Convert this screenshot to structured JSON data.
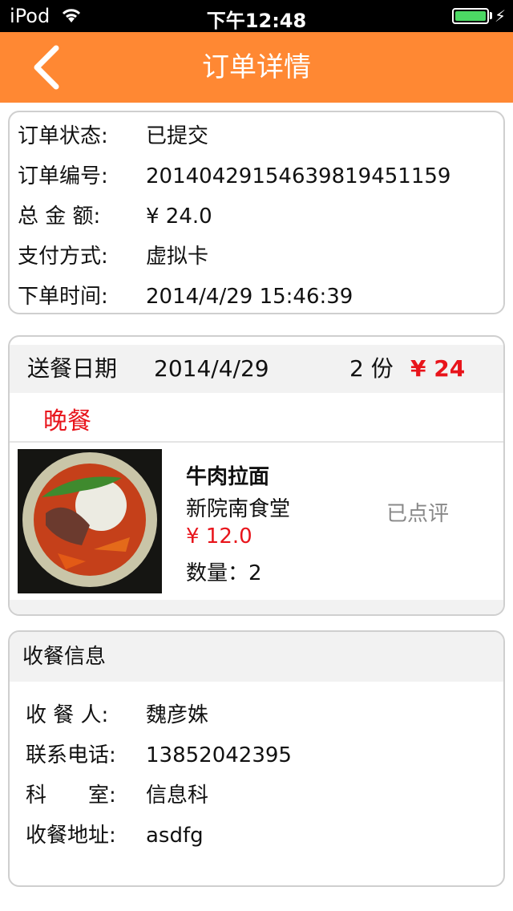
{
  "status_bar": {
    "carrier": "iPod",
    "time": "下午12:48",
    "battery_level": 1.0,
    "icons": [
      "wifi-icon",
      "battery-icon",
      "charging-icon"
    ]
  },
  "nav": {
    "title": "订单详情",
    "back_icon": "chevron-left-icon"
  },
  "order": {
    "status_label": "订单状态:",
    "status_value": "已提交",
    "number_label": "订单编号:",
    "number_value": "20140429154639819451159",
    "amount_label": "总 金 额:",
    "amount_value": "¥ 24.0",
    "payment_label": "支付方式:",
    "payment_value": "虚拟卡",
    "time_label": "下单时间:",
    "time_value": "2014/4/29 15:46:39"
  },
  "meal": {
    "date_label": "送餐日期",
    "date_value": "2014/4/29",
    "count": "2 份",
    "total": "¥ 24",
    "type": "晚餐",
    "item": {
      "name": "牛肉拉面",
      "shop": "新院南食堂",
      "price": "¥ 12.0",
      "quantity": "数量：2",
      "review_status": "已点评"
    }
  },
  "receiver": {
    "header": "收餐信息",
    "name_label": "收 餐 人:",
    "name_value": "魏彦姝",
    "phone_label": "联系电话:",
    "phone_value": "13852042395",
    "dept_label": "科　　室:",
    "dept_value": "信息科",
    "address_label": "收餐地址:",
    "address_value": "asdfg"
  },
  "colors": {
    "nav_bg": "#ff8833",
    "accent_red": "#e8141b",
    "muted": "#888888"
  }
}
